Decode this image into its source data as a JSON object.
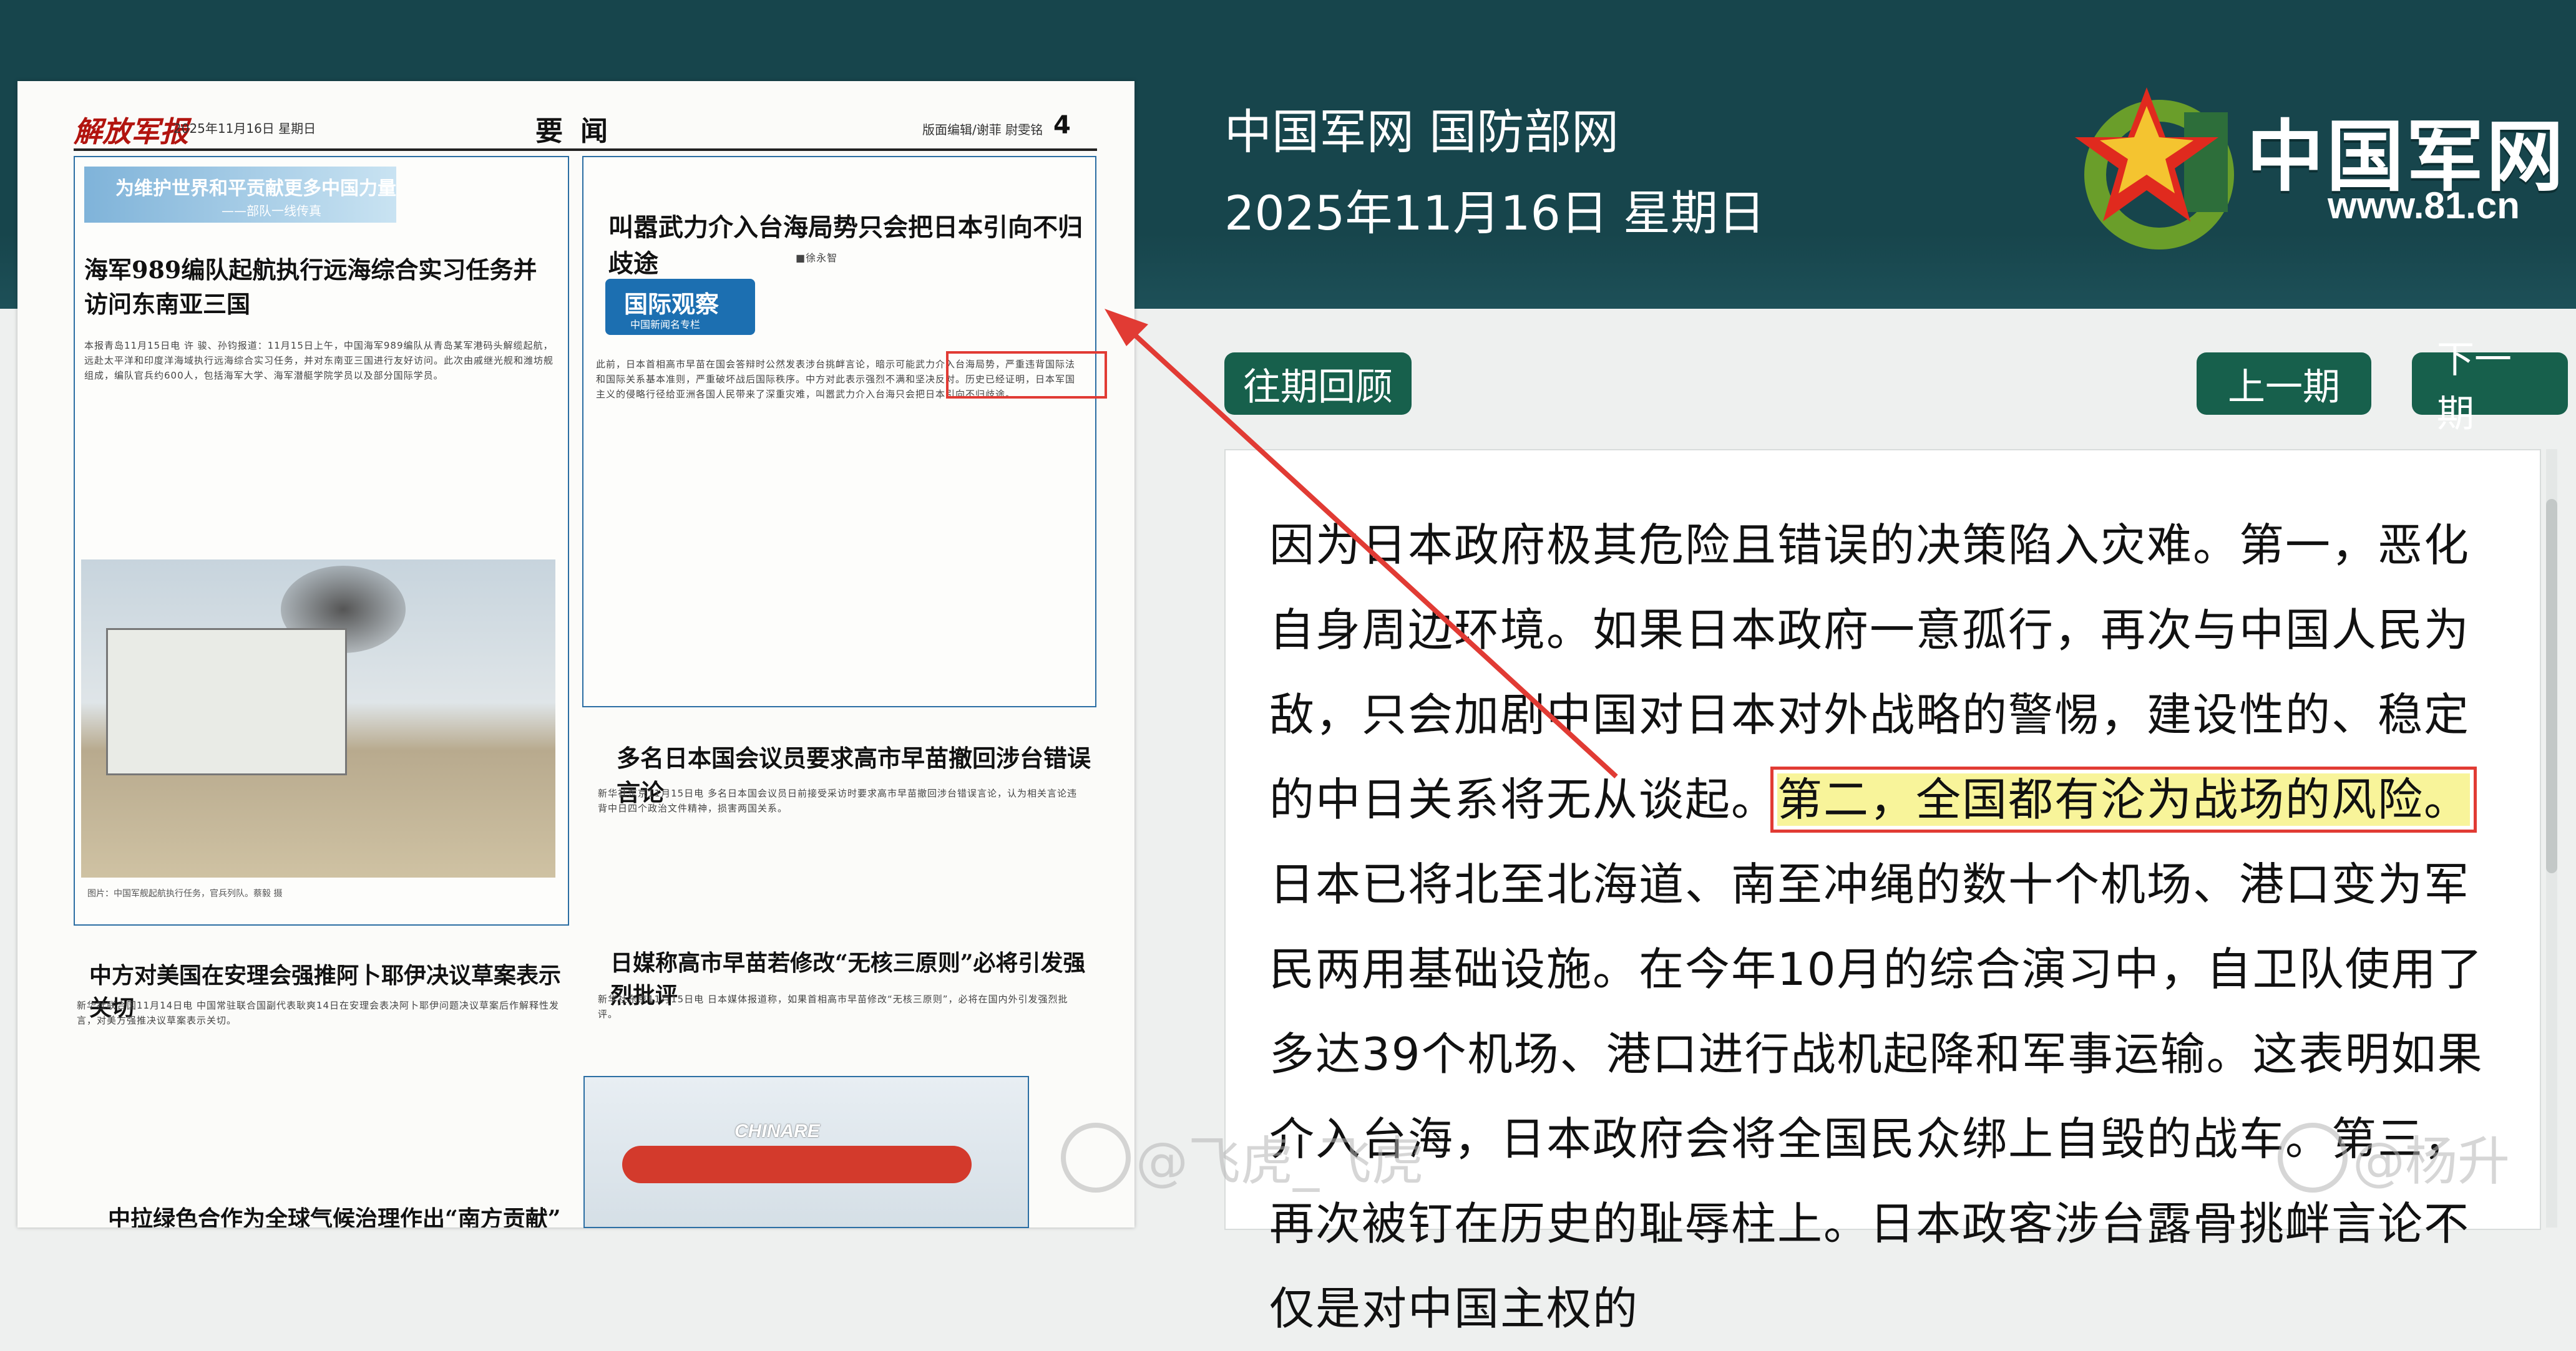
{
  "header": {
    "site_name": "中国军网 国防部网",
    "date": "2025年11月16日 星期日",
    "logo_text": "中国军网",
    "logo_url": "www.81.cn"
  },
  "nav": {
    "archive_label": "往期回顾",
    "prev_label": "上一期",
    "next_label": "下一期"
  },
  "article": {
    "text_before": "因为日本政府极其危险且错误的决策陷入灾难。第一，恶化自身周边环境。如果日本政府一意孤行，再次与中国人民为敌，只会加剧中国对日本对外战略的警惕，建设性的、稳定的中日关系将无从谈起。",
    "highlight": "第二，全国都有沦为战场的风险。",
    "text_after": "日本已将北至北海道、南至冲绳的数十个机场、港口变为军民两用基础设施。在今年10月的综合演习中，自卫队使用了多达39个机场、港口进行战机起降和军事运输。这表明如果介入台海，日本政府会将全国民众绑上自毁的战车。第三，再次被钉在历史的耻辱柱上。日本政客涉台露骨挑衅言论不仅是对中国主权的"
  },
  "newspaper": {
    "masthead": "解放军报",
    "date": "2025年11月16日  星期日",
    "section": "要闻",
    "editors": "版面编辑/谢菲  尉雯铭",
    "page": "4",
    "banner_title": "为维护世界和平贡献更多中国力量",
    "banner_sub": "——部队一线传真",
    "head1": "海军989编队起航执行远海综合实习任务并访问东南亚三国",
    "head2": "叫嚣武力介入台海局势只会把日本引向不归歧途",
    "byline2": "■徐永智",
    "tag_title": "国际观察",
    "tag_sub": "中国新闻名专栏",
    "head3": "多名日本国会议员要求高市早苗撤回涉台错误言论",
    "head4": "日媒称高市早苗若修改“无核三原则”必将引发强烈批评",
    "head5": "中方对美国在安理会强推阿卜耶伊决议草案表示关切",
    "head6": "中拉绿色合作为全球气候治理作出“南方贡献”",
    "body1": "本报青岛11月15日电 许 骏、孙钧报道：11月15日上午，中国海军989编队从青岛某军港码头解缆起航，远赴太平洋和印度洋海域执行远海综合实习任务，并对东南亚三国进行友好访问。此次由戚继光舰和潍坊舰组成，编队官兵约600人，包括海军大学、海军潜艇学院学员以及部分国际学员。",
    "body2": "此前，日本首相高市早苗在国会答辩时公然发表涉台挑衅言论，暗示可能武力介入台海局势，严重违背国际法和国际关系基本准则，严重破坏战后国际秩序。中方对此表示强烈不满和坚决反对。历史已经证明，日本军国主义的侵略行径给亚洲各国人民带来了深重灾难，叫嚣武力介入台海只会把日本引向不归歧途。",
    "body3": "新华社东京11月15日电 多名日本国会议员日前接受采访时要求高市早苗撤回涉台错误言论，认为相关言论违背中日四个政治文件精神，损害两国关系。",
    "body4": "新华社东京11月15日电 日本媒体报道称，如果首相高市早苗修改“无核三原则”，必将在国内外引发强烈批评。",
    "body5": "新华社联合国11月14日电 中国常驻联合国副代表耿爽14日在安理会表决阿卜耶伊问题决议草案后作解释性发言，对美方强推决议草案表示关切。",
    "caption": "图片：中国军舰起航执行任务，官兵列队。蔡毅 摄",
    "plane_label": "CHINARE"
  },
  "watermarks": {
    "left": "@飞虎_飞虎",
    "right": "@杨升"
  },
  "colors": {
    "header_bg": "#17454c",
    "button_bg": "#17604c",
    "highlight_bg": "#f8f49a",
    "annotation_red": "#e13b34"
  }
}
